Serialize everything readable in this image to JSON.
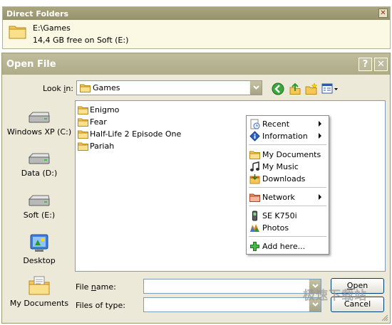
{
  "direct_folders": {
    "title": "Direct Folders",
    "path": "E:\\Games",
    "free_space": "14,4 GB free on Soft (E:)"
  },
  "dialog": {
    "title": "Open File",
    "look_in_label_pre": "Look ",
    "look_in_label_u": "i",
    "look_in_label_post": "n:",
    "look_in_value": "Games",
    "help_glyph": "?",
    "close_glyph": "✕"
  },
  "places": [
    {
      "label": "Windows XP (C:)",
      "icon": "drive-icon"
    },
    {
      "label": "Data (D:)",
      "icon": "drive-icon"
    },
    {
      "label": "Soft (E:)",
      "icon": "drive-icon"
    },
    {
      "label": "Desktop",
      "icon": "desktop-icon"
    },
    {
      "label": "My Documents",
      "icon": "my-documents-icon"
    }
  ],
  "files": [
    "Enigmo",
    "Fear",
    "Half-Life 2 Episode One",
    "Pariah"
  ],
  "context_menu": {
    "items": [
      {
        "label": "Recent",
        "icon": "recent-icon",
        "submenu": true
      },
      {
        "label": "Information",
        "icon": "information-icon",
        "submenu": true
      },
      {
        "label": "My Documents",
        "icon": "folder-icon",
        "submenu": false
      },
      {
        "label": "My Music",
        "icon": "music-icon",
        "submenu": false
      },
      {
        "label": "Downloads",
        "icon": "downloads-icon",
        "submenu": false
      },
      {
        "label": "Network",
        "icon": "network-folder-icon",
        "submenu": true
      },
      {
        "label": "SE K750i",
        "icon": "phone-icon",
        "submenu": false
      },
      {
        "label": "Photos",
        "icon": "photos-icon",
        "submenu": false
      },
      {
        "label": "Add here...",
        "icon": "add-icon",
        "submenu": false
      }
    ]
  },
  "bottom": {
    "file_name_label_pre": "File ",
    "file_name_label_u": "n",
    "file_name_label_post": "ame:",
    "file_name_value": "",
    "files_of_type_label": "Files of type:",
    "files_of_type_value": "",
    "open_label": "Open",
    "open_label_u": "O",
    "open_label_rest": "pen",
    "cancel_label": "Cancel"
  },
  "watermark": "极速下载站",
  "colors": {
    "accent_title": "#aaa780",
    "folder": "#f5c857",
    "button_border": "#003c74"
  }
}
